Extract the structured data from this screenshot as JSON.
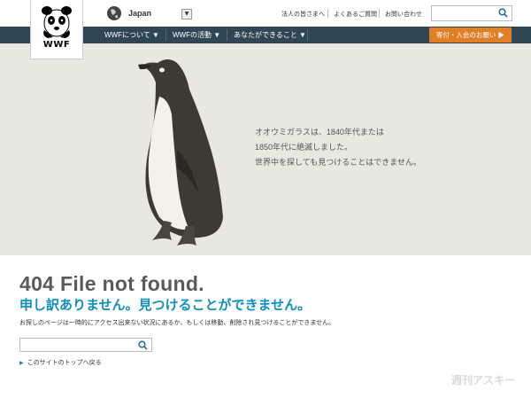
{
  "header": {
    "brand": "WWF",
    "country": "Japan",
    "links": [
      "法人の皆さまへ",
      "よくあるご質問",
      "お問い合わせ"
    ],
    "search_placeholder": ""
  },
  "nav": {
    "items": [
      "WWFについて ▼",
      "WWFの活動 ▼",
      "あなたができること ▼"
    ],
    "donate": "寄付・入会のお願い ▶"
  },
  "hero": {
    "lines": [
      "オオウミガラスは、1840年代または",
      "1850年代に絶滅しました。",
      "世界中を探しても見つけることはできません。"
    ]
  },
  "error": {
    "title": "404 File not found.",
    "subtitle": "申し訳ありません。見つけることができません。",
    "message": "お探しのページは一時的にアクセス出来ない状況にあるか、もしくは移動、削除され見つけることができません。",
    "search_placeholder": "",
    "back_link": "このサイトのトップへ戻る"
  },
  "watermark": "週刊アスキー",
  "colors": {
    "nav": "#2f4754",
    "accent": "#0d8fbf",
    "donate": "#e07f26",
    "hero_bg": "#e9e8e0"
  }
}
